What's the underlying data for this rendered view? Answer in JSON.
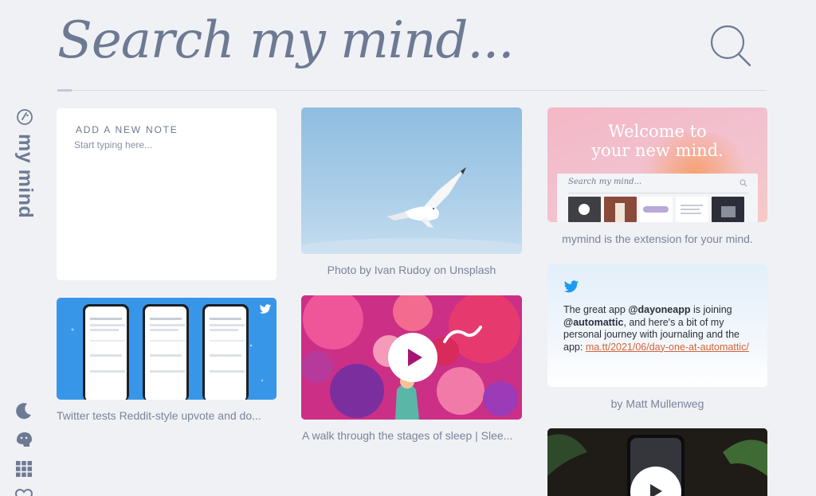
{
  "header": {
    "search_placeholder": "Search my mind..."
  },
  "sidebar": {
    "brand": "my mind",
    "icons": [
      "moon-icon",
      "brain-icon",
      "grid-icon",
      "heart-icon"
    ]
  },
  "note": {
    "label": "ADD A NEW NOTE",
    "placeholder": "Start typing here..."
  },
  "cards": {
    "bird": {
      "caption": "Photo by Ivan Rudoy on Unsplash"
    },
    "welcome": {
      "title_line1": "Welcome to",
      "title_line2": "your new mind.",
      "mini_search": "Search my mind...",
      "caption": "mymind is the extension for your mind."
    },
    "tweet": {
      "text_1": "The great app ",
      "mention_1": "@dayoneapp",
      "text_2": " is joining ",
      "mention_2": "@automattic",
      "text_3": ", and here's a bit of my personal journey with journaling and the app: ",
      "link": "ma.tt/2021/06/day-one-at-automattic/",
      "caption": "by Matt Mullenweg"
    },
    "twitter_tests": {
      "caption": "Twitter tests Reddit-style upvote and do..."
    },
    "sleep": {
      "caption": "A walk through the stages of sleep | Slee..."
    }
  },
  "colors": {
    "background": "#f0f1f5",
    "text": "#6d7a94",
    "link": "#d4643a",
    "twitter_blue": "#1d9bf0"
  }
}
